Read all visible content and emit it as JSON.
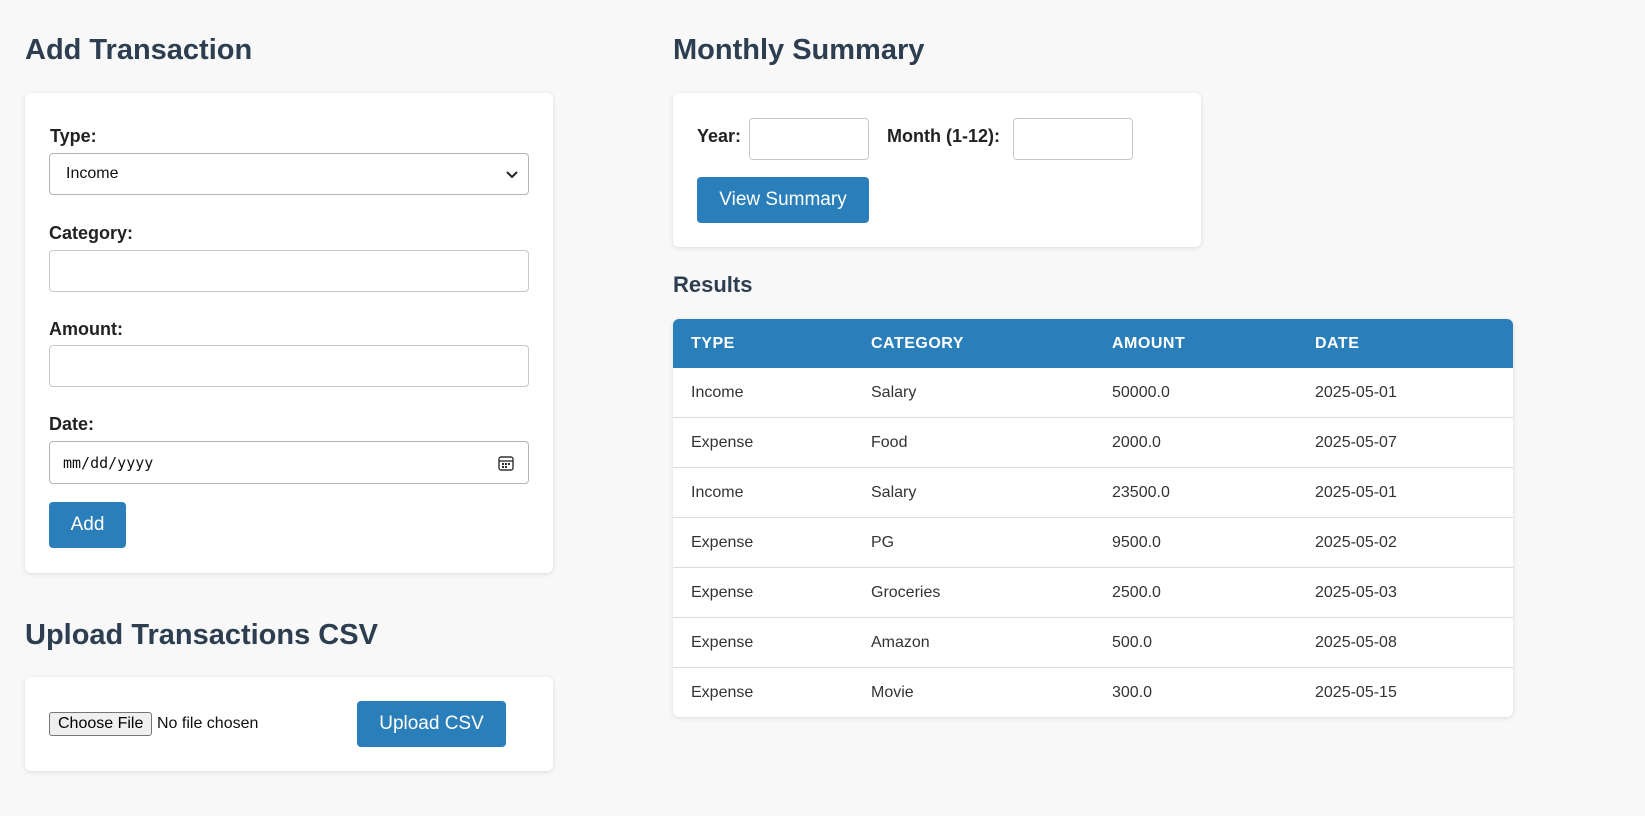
{
  "add_transaction": {
    "title": "Add Transaction",
    "type_label": "Type:",
    "type_selected": "Income",
    "category_label": "Category:",
    "category_value": "",
    "amount_label": "Amount:",
    "amount_value": "",
    "date_label": "Date:",
    "date_placeholder": "mm/dd/yyyy",
    "add_button": "Add"
  },
  "upload": {
    "title": "Upload Transactions CSV",
    "choose_file_button": "Choose File",
    "file_status": "No file chosen",
    "upload_button": "Upload CSV"
  },
  "summary": {
    "title": "Monthly Summary",
    "year_label": "Year:",
    "year_value": "",
    "month_label": "Month (1-12):",
    "month_value": "",
    "view_button": "View Summary"
  },
  "results": {
    "title": "Results",
    "columns": [
      "TYPE",
      "CATEGORY",
      "AMOUNT",
      "DATE"
    ],
    "rows": [
      [
        "Income",
        "Salary",
        "50000.0",
        "2025-05-01"
      ],
      [
        "Expense",
        "Food",
        "2000.0",
        "2025-05-07"
      ],
      [
        "Income",
        "Salary",
        "23500.0",
        "2025-05-01"
      ],
      [
        "Expense",
        "PG",
        "9500.0",
        "2025-05-02"
      ],
      [
        "Expense",
        "Groceries",
        "2500.0",
        "2025-05-03"
      ],
      [
        "Expense",
        "Amazon",
        "500.0",
        "2025-05-08"
      ],
      [
        "Expense",
        "Movie",
        "300.0",
        "2025-05-15"
      ]
    ]
  },
  "colors": {
    "accent": "#2a7fba",
    "heading": "#2c3e50",
    "background": "#f8f8f8"
  },
  "icons": {
    "select_arrow": "chevron-down-icon",
    "date_picker": "calendar-icon"
  }
}
